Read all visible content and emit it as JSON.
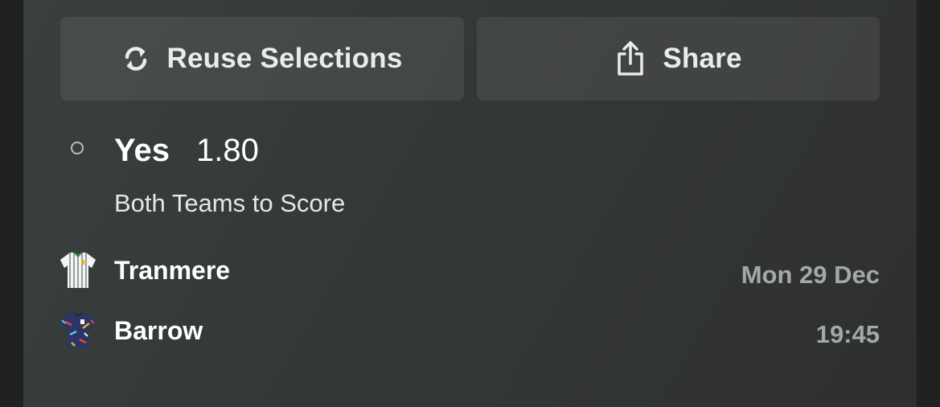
{
  "actions": {
    "reuse_label": "Reuse Selections",
    "reuse_icon": "refresh-icon",
    "share_label": "Share",
    "share_icon": "share-icon"
  },
  "selection": {
    "name": "Yes",
    "odds": "1.80",
    "market": "Both Teams to Score"
  },
  "event": {
    "home_team": "Tranmere",
    "away_team": "Barrow",
    "date": "Mon 29 Dec",
    "time": "19:45"
  },
  "colors": {
    "background": "#202221",
    "card": "#343937",
    "button": "#414644",
    "text_primary": "#ffffff",
    "text_muted": "#a4a8a6"
  }
}
